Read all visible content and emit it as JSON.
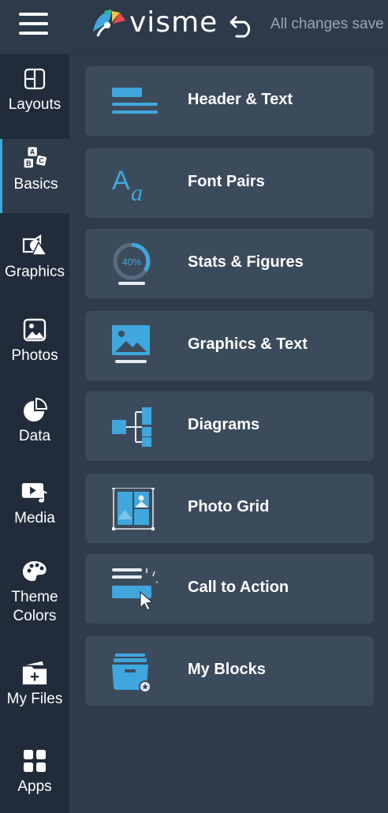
{
  "header": {
    "menu_icon": "hamburger-menu-icon",
    "logo_text": "visme",
    "undo_icon": "undo-icon",
    "save_status": "All changes save"
  },
  "sidebar": {
    "items": [
      {
        "label": "Layouts",
        "icon": "layouts-icon"
      },
      {
        "label": "Basics",
        "icon": "abc-blocks-icon",
        "active": true
      },
      {
        "label": "Graphics",
        "icon": "graphics-icon"
      },
      {
        "label": "Photos",
        "icon": "photo-icon"
      },
      {
        "label": "Data",
        "icon": "pie-chart-icon"
      },
      {
        "label": "Media",
        "icon": "media-icon"
      },
      {
        "label": "Theme\nColors",
        "icon": "palette-icon"
      },
      {
        "label": "My Files",
        "icon": "folder-icon"
      },
      {
        "label": "Apps",
        "icon": "apps-grid-icon"
      }
    ]
  },
  "panel": {
    "cards": [
      {
        "label": "Header & Text",
        "icon": "header-text-icon"
      },
      {
        "label": "Font Pairs",
        "icon": "font-pairs-icon"
      },
      {
        "label": "Stats & Figures",
        "icon": "stats-figures-icon",
        "stat_text": "40%"
      },
      {
        "label": "Graphics & Text",
        "icon": "graphics-text-icon"
      },
      {
        "label": "Diagrams",
        "icon": "diagram-icon"
      },
      {
        "label": "Photo Grid",
        "icon": "photo-grid-icon"
      },
      {
        "label": "Call to Action",
        "icon": "call-to-action-icon"
      },
      {
        "label": "My Blocks",
        "icon": "my-blocks-icon"
      }
    ]
  },
  "colors": {
    "accent": "#3fa7dd",
    "sidebar_bg": "#202c3a",
    "panel_bg": "#2e3b4b",
    "card_bg": "#3c4b5c"
  }
}
